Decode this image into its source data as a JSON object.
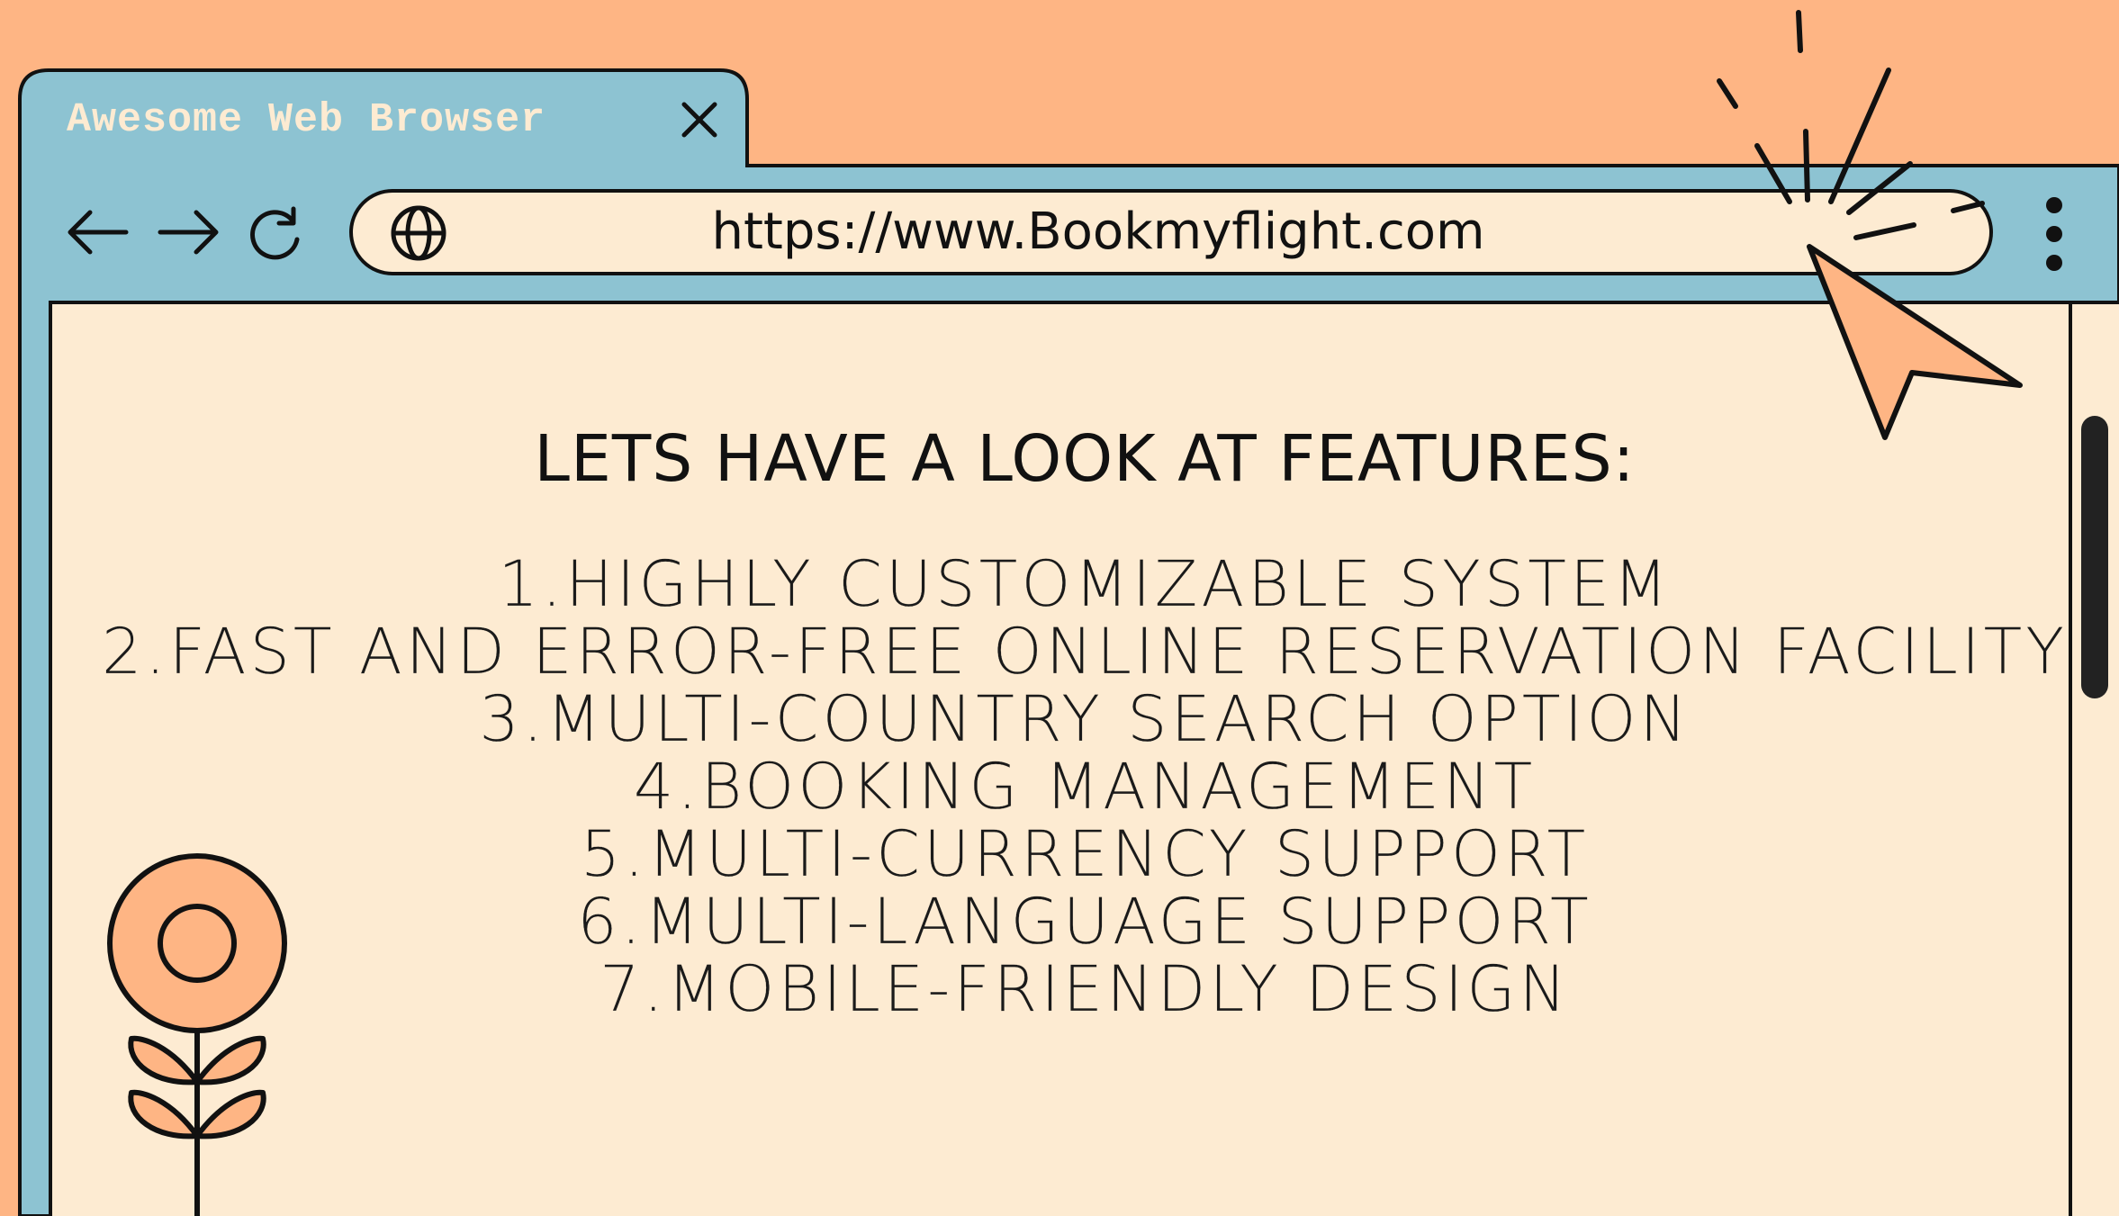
{
  "window": {
    "tab_title": "Awesome Web Browser",
    "close_icon": "close-icon"
  },
  "toolbar": {
    "back_icon": "arrow-left-icon",
    "forward_icon": "arrow-right-icon",
    "reload_icon": "reload-icon",
    "globe_icon": "globe-icon",
    "url": "https://www.Bookmyflight.com",
    "menu_icon": "kebab-menu-icon"
  },
  "content": {
    "heading": "LETS HAVE A LOOK AT FEATURES:",
    "features": [
      "1.HIGHLY CUSTOMIZABLE SYSTEM",
      "2.FAST AND ERROR-FREE ONLINE RESERVATION FACILITY",
      "3.MULTI-COUNTRY SEARCH OPTION",
      "4.BOOKING MANAGEMENT",
      "5.MULTI-CURRENCY SUPPORT",
      "6.MULTI-LANGUAGE SUPPORT",
      "7.MOBILE-FRIENDLY DESIGN"
    ]
  },
  "colors": {
    "background": "#FEB584",
    "chrome": "#8DC3D2",
    "page": "#FDEBD2",
    "outline": "#111111",
    "accent": "#FEB584"
  }
}
